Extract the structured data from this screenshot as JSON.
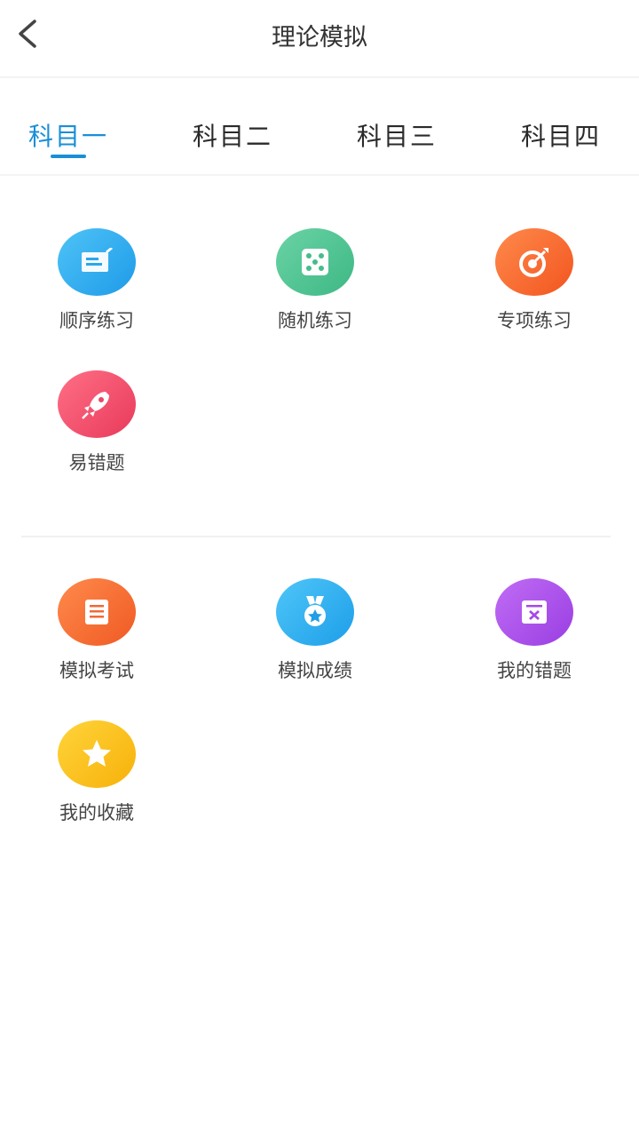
{
  "header": {
    "title": "理论模拟",
    "back_icon": "chevron-left-icon"
  },
  "tabs": [
    {
      "label": "科目一",
      "active": true
    },
    {
      "label": "科目二",
      "active": false
    },
    {
      "label": "科目三",
      "active": false
    },
    {
      "label": "科目四",
      "active": false
    }
  ],
  "practice": [
    {
      "label": "顺序练习",
      "icon": "card-icon",
      "color": "#1e9be8"
    },
    {
      "label": "随机练习",
      "icon": "dice-icon",
      "color": "#3db885"
    },
    {
      "label": "专项练习",
      "icon": "target-icon",
      "color": "#f2551f"
    },
    {
      "label": "易错题",
      "icon": "rocket-icon",
      "color": "#e83a5a"
    }
  ],
  "exam": [
    {
      "label": "模拟考试",
      "icon": "document-icon",
      "color": "#ef5a23"
    },
    {
      "label": "模拟成绩",
      "icon": "medal-icon",
      "color": "#1d9ee9"
    },
    {
      "label": "我的错题",
      "icon": "error-box-icon",
      "color": "#9a3ee2"
    },
    {
      "label": "我的收藏",
      "icon": "star-icon",
      "color": "#f7b10a"
    }
  ],
  "colors": {
    "accent": "#1a8fd6",
    "text": "#333333"
  }
}
